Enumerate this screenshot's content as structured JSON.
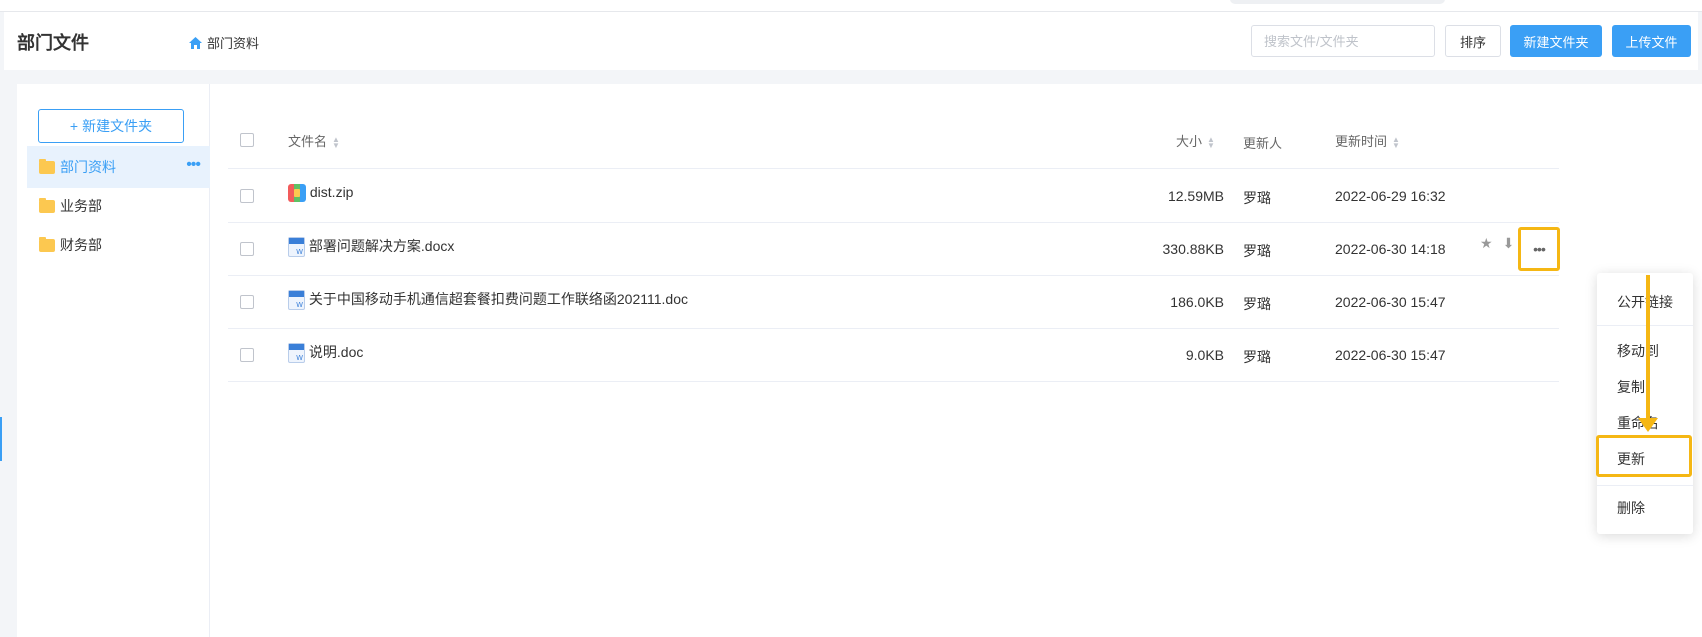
{
  "header": {
    "title": "部门文件",
    "breadcrumb": "部门资料",
    "search_placeholder": "搜索文件/文件夹",
    "sort_label": "排序",
    "new_folder_label": "新建文件夹",
    "upload_label": "上传文件"
  },
  "sidebar": {
    "new_folder_label": "新建文件夹",
    "items": [
      {
        "label": "部门资料",
        "active": true
      },
      {
        "label": "业务部"
      },
      {
        "label": "财务部"
      }
    ]
  },
  "table": {
    "headers": {
      "name": "文件名",
      "size": "大小",
      "updater": "更新人",
      "time": "更新时间"
    },
    "rows": [
      {
        "name": "dist.zip",
        "icon": "zip-icon",
        "size": "12.59MB",
        "updater": "罗璐",
        "time": "2022-06-29 16:32"
      },
      {
        "name": "部署问题解决方案.docx",
        "icon": "word-doc-icon",
        "size": "330.88KB",
        "updater": "罗璐",
        "time": "2022-06-30 14:18"
      },
      {
        "name": "关于中国移动手机通信超套餐扣费问题工作联络函202111.doc",
        "icon": "word-doc-icon",
        "size": "186.0KB",
        "updater": "罗璐",
        "time": "2022-06-30 15:47"
      },
      {
        "name": "说明.doc",
        "icon": "word-doc-icon",
        "size": "9.0KB",
        "updater": "罗璐",
        "time": "2022-06-30 15:47"
      }
    ]
  },
  "context_menu": {
    "items": [
      "公开链接",
      "移动到",
      "复制",
      "重命名",
      "更新",
      "删除"
    ],
    "highlighted": "更新"
  },
  "colors": {
    "accent": "#3a9ff5",
    "highlight": "#f5b714",
    "folder": "#fcc850"
  }
}
